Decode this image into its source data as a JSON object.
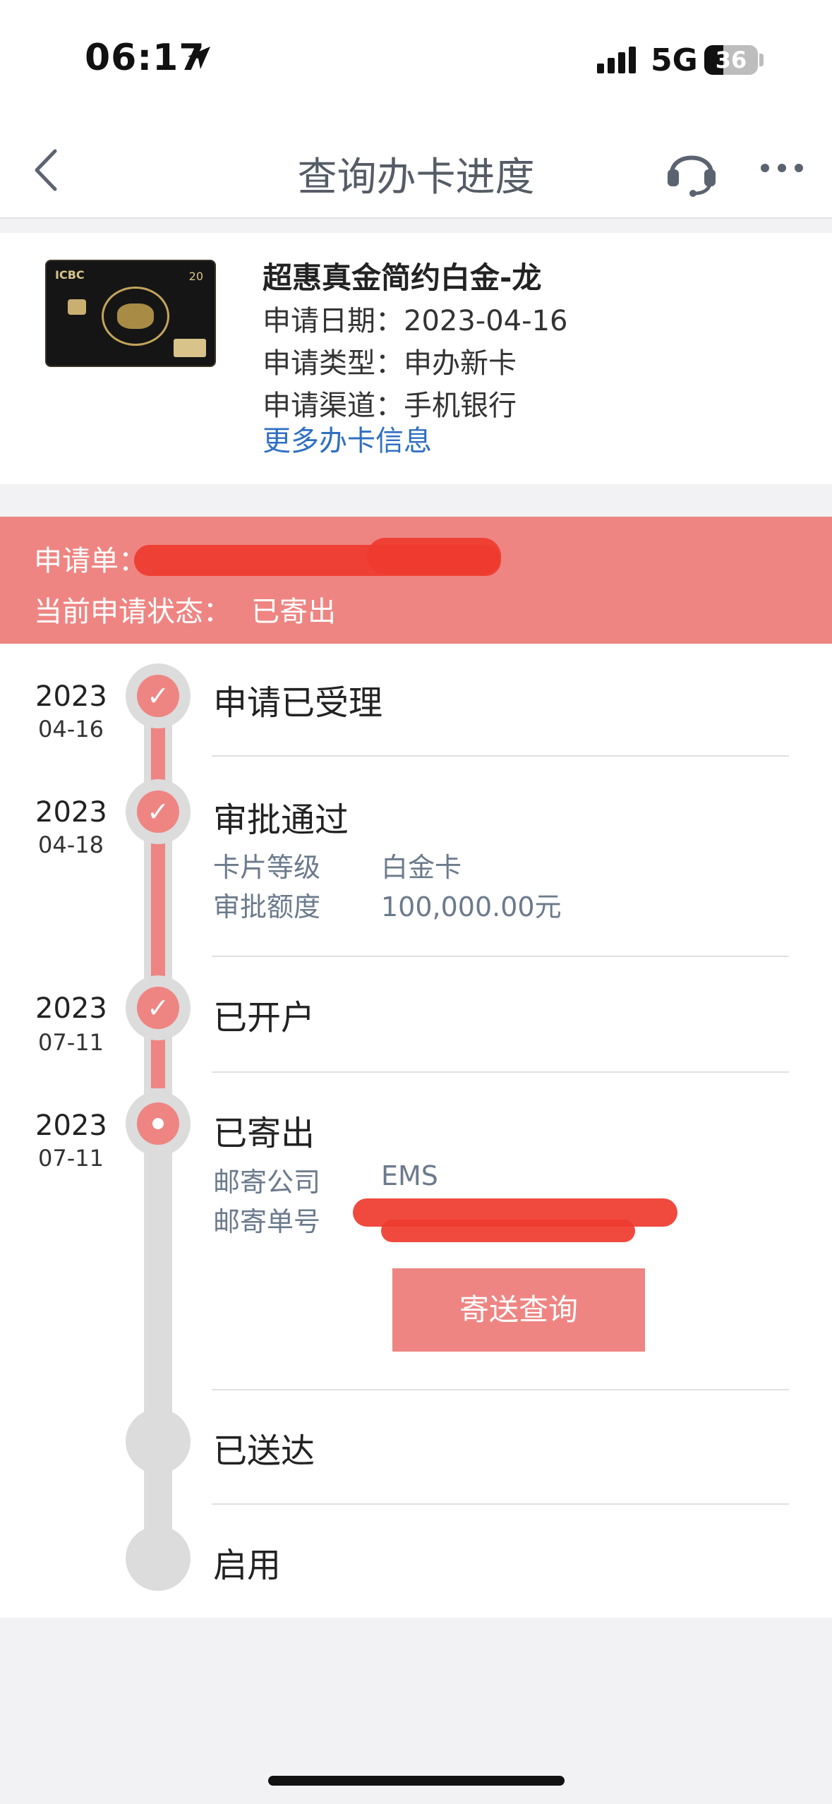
{
  "status_bar": {
    "time": "06:17",
    "network": "5G",
    "battery": "36",
    "battery_level": 0.36
  },
  "nav": {
    "title": "查询办卡进度",
    "back_icon": "chevron-left-icon",
    "support_icon": "headset-icon",
    "more_icon": "more-dots-icon"
  },
  "card": {
    "name": "超惠真金简约白金-龙",
    "apply_date_label": "申请日期：",
    "apply_date": "2023-04-16",
    "apply_type_label": "申请类型：",
    "apply_type": "申办新卡",
    "apply_channel_label": "申请渠道：",
    "apply_channel": "手机银行",
    "more_link": "更多办卡信息",
    "image_text": {
      "brand": "ICBC",
      "number": "20"
    }
  },
  "banner": {
    "order_label": "申请单：",
    "status_label": "当前申请状态：",
    "status_value": "已寄出"
  },
  "timeline": [
    {
      "year": "2023",
      "date": "04-16",
      "title": "申请已受理",
      "done": true
    },
    {
      "year": "2023",
      "date": "04-18",
      "title": "审批通过",
      "done": true,
      "details": [
        {
          "label": "卡片等级",
          "value": "白金卡"
        },
        {
          "label": "审批额度",
          "value": "100,000.00元"
        }
      ]
    },
    {
      "year": "2023",
      "date": "07-11",
      "title": "已开户",
      "done": true
    },
    {
      "year": "2023",
      "date": "07-11",
      "title": "已寄出",
      "current": true,
      "details": [
        {
          "label": "邮寄公司",
          "value": "EMS"
        },
        {
          "label": "邮寄单号",
          "value": ""
        }
      ],
      "button": "寄送查询"
    },
    {
      "title": "已送达",
      "done": false
    },
    {
      "title": "启用",
      "done": false
    }
  ],
  "colors": {
    "accent": "#ee8582",
    "link": "#2f6fc1",
    "muted": "#6b7a8c"
  }
}
